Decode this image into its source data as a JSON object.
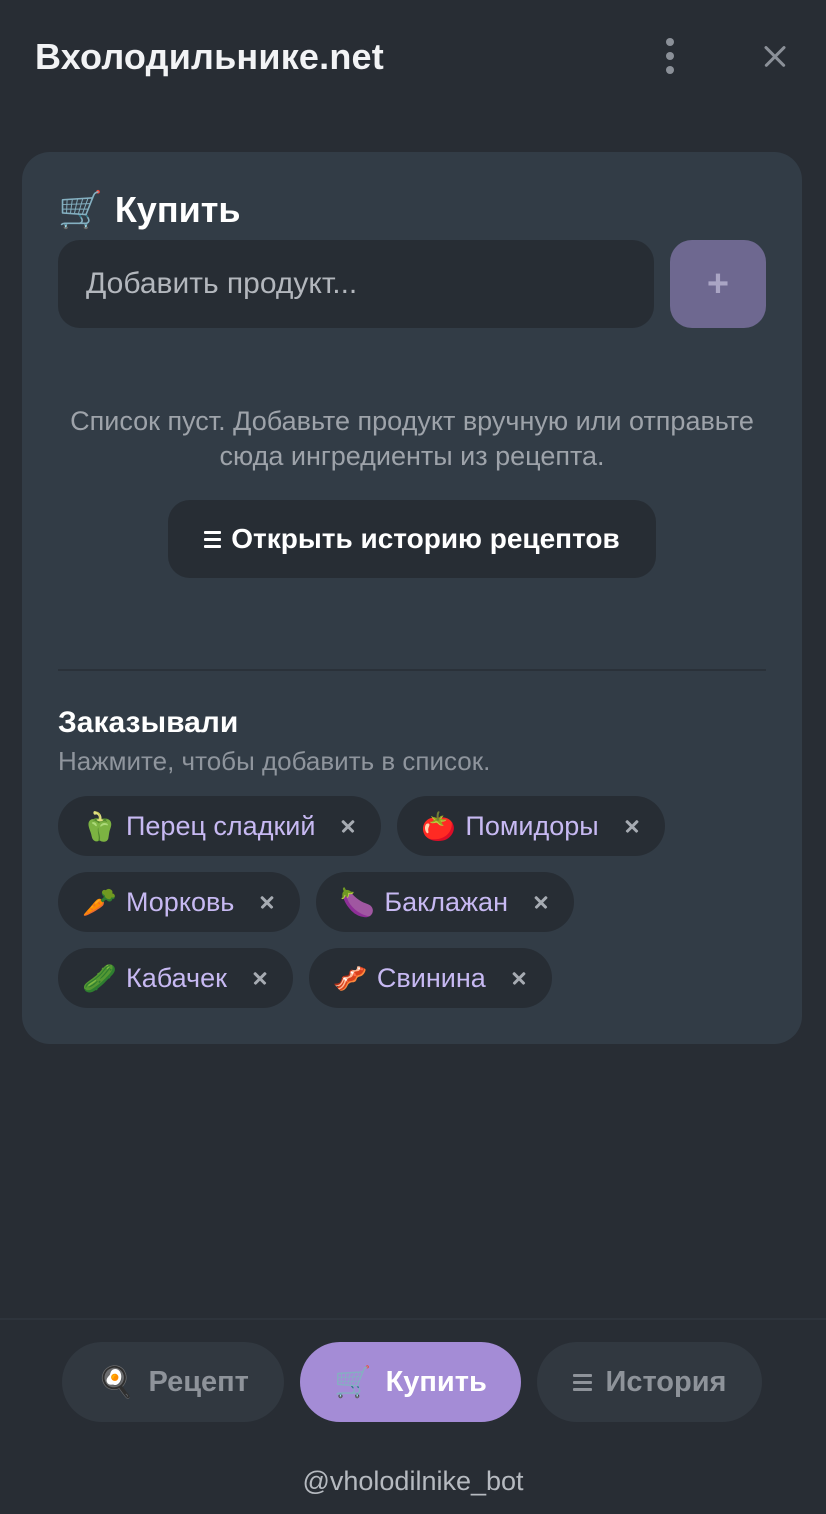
{
  "header": {
    "title": "Вхолодильнике.net",
    "menu_icon": "kebab-menu-icon",
    "close_icon": "close-icon"
  },
  "buy_section": {
    "emoji": "🛒",
    "title": "Купить",
    "input_placeholder": "Добавить продукт...",
    "input_value": "",
    "add_button_label": "+",
    "empty_text": "Список пуст. Добавьте продукт вручную или отправьте сюда ингредиенты из рецепта.",
    "history_button_label": "Открыть историю рецептов"
  },
  "ordered": {
    "title": "Заказывали",
    "hint": "Нажмите, чтобы добавить в список.",
    "items": [
      {
        "emoji": "🫑",
        "label": "Перец сладкий"
      },
      {
        "emoji": "🍅",
        "label": "Помидоры"
      },
      {
        "emoji": "🥕",
        "label": "Морковь"
      },
      {
        "emoji": "🍆",
        "label": "Баклажан"
      },
      {
        "emoji": "🥒",
        "label": "Кабачек"
      },
      {
        "emoji": "🥓",
        "label": "Свинина"
      }
    ]
  },
  "nav": {
    "recipe": {
      "emoji": "🍳",
      "label": "Рецепт"
    },
    "buy": {
      "emoji": "🛒",
      "label": "Купить"
    },
    "history": {
      "label": "История"
    },
    "active": "buy"
  },
  "footer": {
    "bot_handle": "@vholodilnike_bot"
  },
  "colors": {
    "background": "#282d34",
    "card": "#323c46",
    "accent": "#a48cd6",
    "chip_text": "#c7b9f2"
  }
}
